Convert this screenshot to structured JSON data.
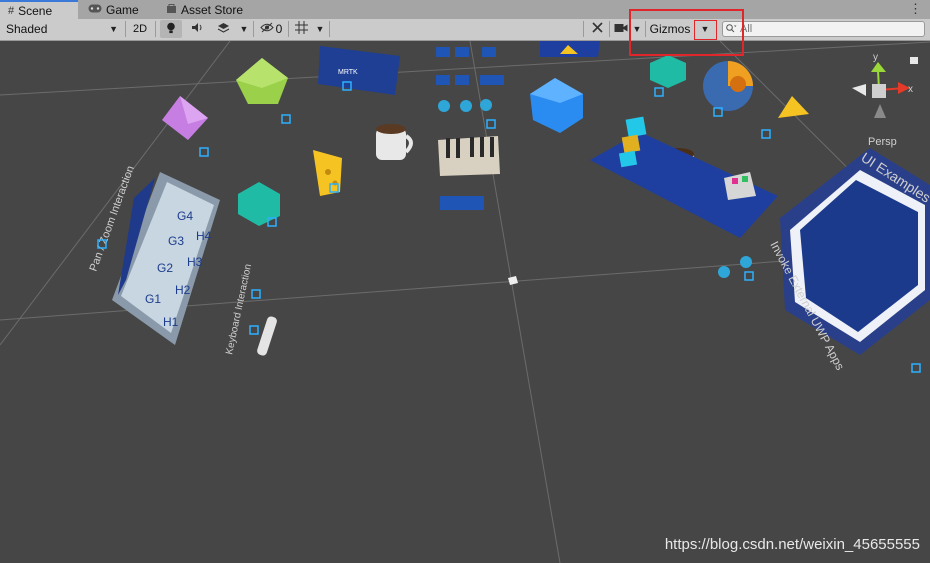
{
  "tabs": [
    {
      "label": "Scene",
      "icon": "grid-icon"
    },
    {
      "label": "Game",
      "icon": "gamepad-icon"
    },
    {
      "label": "Asset Store",
      "icon": "store-icon"
    }
  ],
  "toolbar": {
    "shading_mode": "Shaded",
    "mode_2d": "2D",
    "hidden_count": "0",
    "gizmos_label": "Gizmos",
    "search_placeholder": "All"
  },
  "scene": {
    "gizmo_view_label": "Persp",
    "axis_labels": {
      "x": "x",
      "y": "y"
    },
    "labels": {
      "pan_zoom": "Pan / Zoom Interaction",
      "keyboard": "Keyboard Interaction",
      "external_apps": "Invoke External UWP Apps",
      "examples": "UI Examples"
    },
    "grid_cells": [
      "G4",
      "G3",
      "G2",
      "G1",
      "H4",
      "H3",
      "H2",
      "H1"
    ]
  },
  "watermark": "https://blog.csdn.net/weixin_45655555",
  "colors": {
    "tab_bar": "#a5a5a5",
    "toolbar": "#cbcbcb",
    "viewport": "#464646",
    "active_tab_accent": "#3a79d8",
    "highlight": "#e0262a"
  }
}
